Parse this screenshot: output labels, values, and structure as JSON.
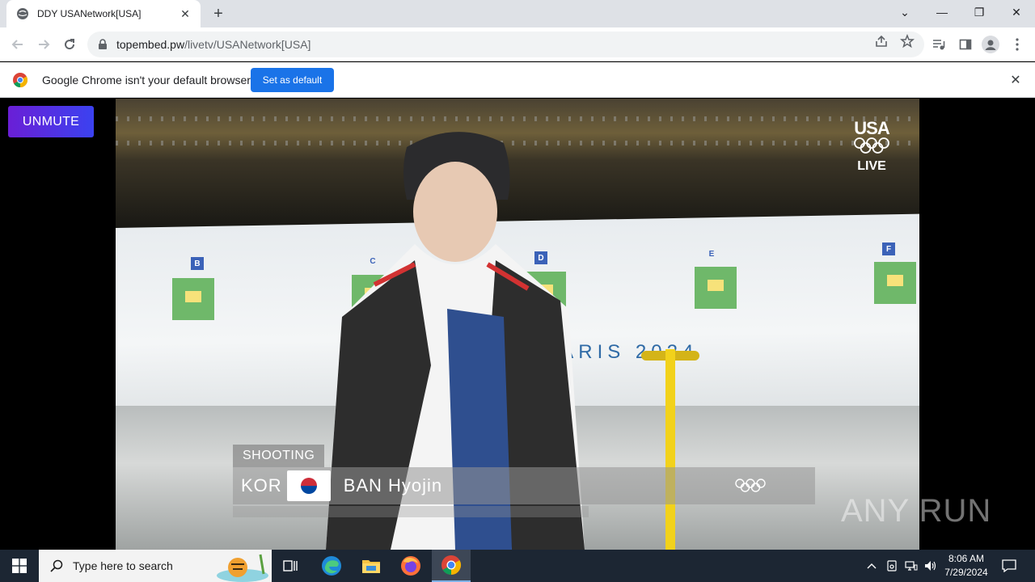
{
  "browser": {
    "tab": {
      "title": "DDY USANetwork[USA]"
    },
    "address": {
      "host": "topembed.pw",
      "path": "/livetv/USANetwork[USA]"
    },
    "infobar": {
      "message": "Google Chrome isn't your default browser",
      "button": "Set as default"
    }
  },
  "page": {
    "unmute_label": "UNMUTE",
    "video": {
      "network_logo": "USA",
      "live_label": "LIVE",
      "venue_text": "PARIS 2024",
      "lanes": [
        "B",
        "C",
        "D",
        "E",
        "F"
      ],
      "lower_third": {
        "sport": "SHOOTING",
        "country": "KOR",
        "athlete": "BAN Hyojin"
      }
    },
    "watermark": "ANY RUN"
  },
  "taskbar": {
    "search_placeholder": "Type here to search",
    "time": "8:06 AM",
    "date": "7/29/2024"
  },
  "colors": {
    "accent": "#1a73e8",
    "unmute_start": "#6a1fd6",
    "unmute_end": "#3b42f0",
    "taskbar": "#1c2633"
  }
}
